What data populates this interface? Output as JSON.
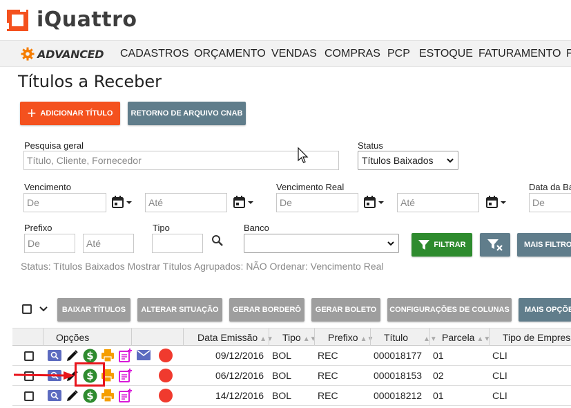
{
  "app": {
    "brand": "iQuattro",
    "edition": "ADVANCED"
  },
  "nav": {
    "items": [
      "CADASTROS",
      "ORÇAMENTO",
      "VENDAS",
      "COMPRAS",
      "PCP",
      "ESTOQUE",
      "FATURAMENTO",
      "F"
    ]
  },
  "page": {
    "title": "Títulos a Receber"
  },
  "actions": {
    "add_title": "ADICIONAR TÍTULO",
    "cnab_return": "RETORNO DE ARQUIVO CNAB"
  },
  "filters": {
    "search_label": "Pesquisa geral",
    "search_placeholder": "Título, Cliente, Fornecedor",
    "status_label": "Status",
    "status_value": "Títulos Baixados",
    "due_label": "Vencimento",
    "real_due_label": "Vencimento Real",
    "issue_date_label": "Data da Ba",
    "from_placeholder": "De",
    "to_placeholder": "Até",
    "prefix_label": "Prefixo",
    "type_label": "Tipo",
    "bank_label": "Banco",
    "filter_button": "FILTRAR",
    "more_filters": "MAIS FILTROS",
    "summary": "Status: Títulos Baixados  Mostrar Títulos Agrupados: NÃO  Ordenar: Vencimento Real"
  },
  "toolbar": {
    "write_off": "BAIXAR TÍTULOS",
    "change_status": "ALTERAR SITUAÇÃO",
    "generate_bordero": "GERAR BORDERÔ",
    "generate_boleto": "GERAR BOLETO",
    "column_settings": "CONFIGURAÇÕES DE COLUNAS",
    "more_options": "MAIS OPÇÕES"
  },
  "table": {
    "columns": [
      "Opções",
      "Data Emissão",
      "Tipo",
      "Prefixo",
      "Título",
      "Parcela",
      "Tipo de Empresa"
    ],
    "rows": [
      {
        "date": "09/12/2016",
        "type": "BOL",
        "prefix": "REC",
        "title": "000018177",
        "installment": "01",
        "company_type": "CLI"
      },
      {
        "date": "06/12/2016",
        "type": "BOL",
        "prefix": "REC",
        "title": "000018153",
        "installment": "02",
        "company_type": "CLI"
      },
      {
        "date": "14/12/2016",
        "type": "BOL",
        "prefix": "REC",
        "title": "000018212",
        "installment": "01",
        "company_type": "CLI"
      }
    ]
  },
  "colors": {
    "accent_orange": "#f4511e",
    "button_grey": "#607d8b",
    "filter_green": "#2e8b2e",
    "status_red": "#f03a2e",
    "highlight_red": "#e8141c"
  }
}
